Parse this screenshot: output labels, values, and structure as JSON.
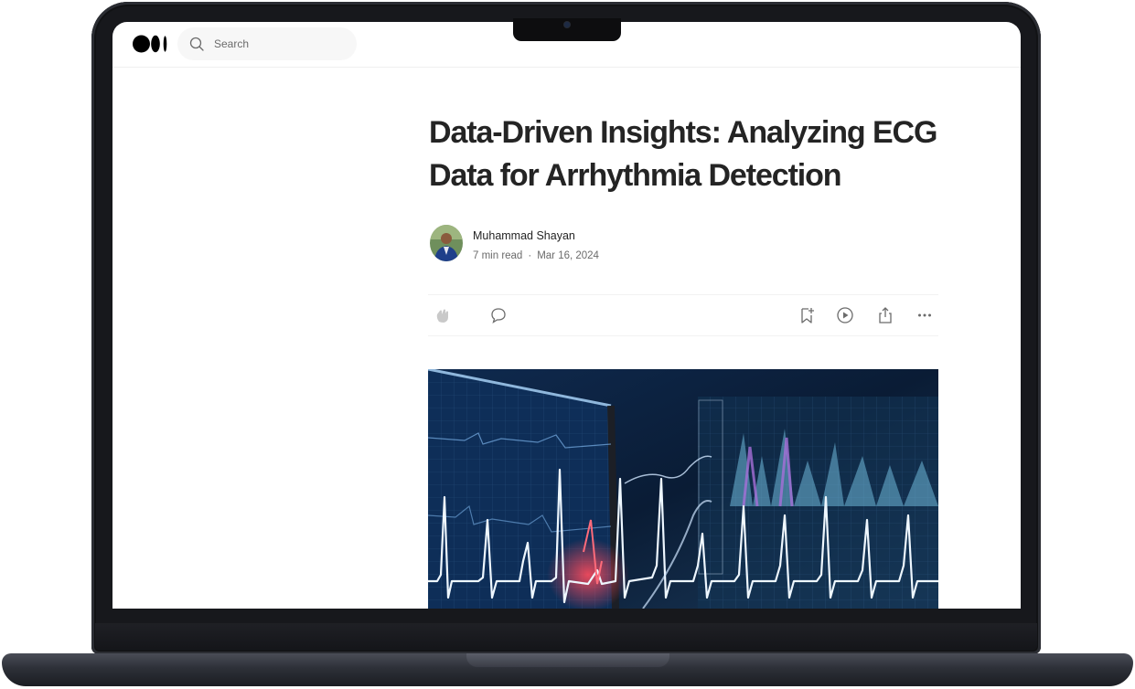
{
  "site": {
    "logo_icon": "medium-logo-icon",
    "search": {
      "placeholder": "Search",
      "icon": "search-icon"
    }
  },
  "article": {
    "title": "Data-Driven Insights: Analyzing ECG Data for Arrhythmia Detection",
    "author": "Muhammad Shayan",
    "read_time": "7 min read",
    "separator": "·",
    "date": "Mar 16, 2024"
  },
  "actions": {
    "clap_icon": "clap-icon",
    "comment_icon": "comment-icon",
    "bookmark_icon": "bookmark-add-icon",
    "listen_icon": "play-circle-icon",
    "share_icon": "share-icon",
    "more_icon": "more-icon"
  },
  "colors": {
    "text": "#242424",
    "muted": "#6b6b6b",
    "hero_bg": "#0b1b33",
    "ecg_line": "#e8f4ff",
    "ecg_highlight": "#ff3b4f"
  }
}
